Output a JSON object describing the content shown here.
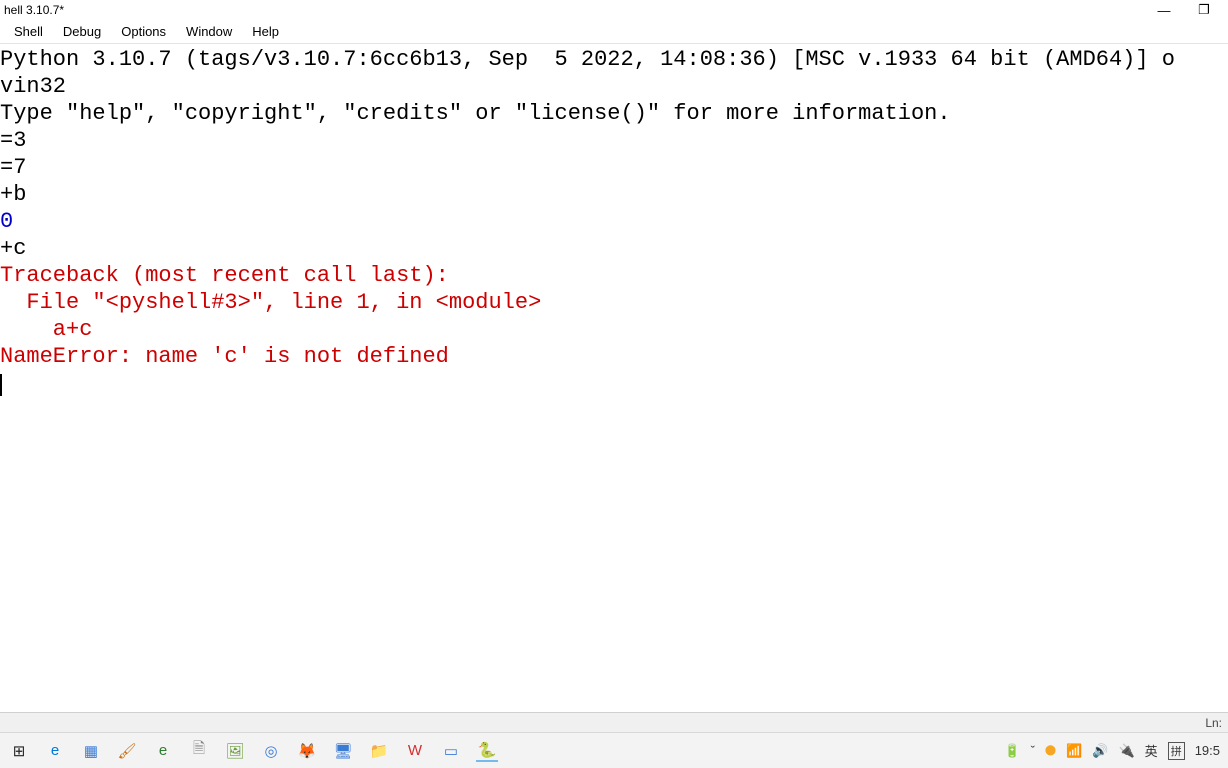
{
  "window": {
    "title": "hell 3.10.7*",
    "min": "—",
    "restore": "❐"
  },
  "menu": {
    "items": [
      "Shell",
      "Debug",
      "Options",
      "Window",
      "Help"
    ]
  },
  "shell": {
    "banner1": "Python 3.10.7 (tags/v3.10.7:6cc6b13, Sep  5 2022, 14:08:36) [MSC v.1933 64 bit (AMD64)] o",
    "banner2": "vin32",
    "banner3": "Type \"help\", \"copyright\", \"credits\" or \"license()\" for more information.",
    "in1": "=3",
    "in2": "=7",
    "in3": "+b",
    "out1": "0",
    "in4": "+c",
    "tb1": "Traceback (most recent call last):",
    "tb2": "  File \"<pyshell#3>\", line 1, in <module>",
    "tb3": "    a+c",
    "tb4": "NameError: name 'c' is not defined"
  },
  "status": {
    "text": "Ln: "
  },
  "taskbar": {
    "icons": [
      {
        "name": "start-icon",
        "glyph": "⊞",
        "color": "#222"
      },
      {
        "name": "edge-icon",
        "glyph": "e",
        "color": "#0078d7"
      },
      {
        "name": "calculator-icon",
        "glyph": "▦",
        "color": "#3a7bd5"
      },
      {
        "name": "paint-icon",
        "glyph": "🖌",
        "color": "#c96f12"
      },
      {
        "name": "edge2-icon",
        "glyph": "e",
        "color": "#2e7d32"
      },
      {
        "name": "document-icon",
        "glyph": "🗎",
        "color": "#888"
      },
      {
        "name": "image-icon",
        "glyph": "🖼",
        "color": "#6b9e3e"
      },
      {
        "name": "cortana-icon",
        "glyph": "◎",
        "color": "#3a7bd5"
      },
      {
        "name": "firefox-icon",
        "glyph": "🦊",
        "color": "#e66000"
      },
      {
        "name": "display-icon",
        "glyph": "🖥",
        "color": "#3a7bd5"
      },
      {
        "name": "explorer-icon",
        "glyph": "📁",
        "color": "#f6b73c"
      },
      {
        "name": "wps-icon",
        "glyph": "W",
        "color": "#d32f2f"
      },
      {
        "name": "monitor-icon",
        "glyph": "▭",
        "color": "#3a7bd5"
      },
      {
        "name": "python-icon",
        "glyph": "🐍",
        "color": "#3776ab",
        "active": true
      }
    ],
    "tray": {
      "battery": "🔋",
      "chevron": "ˇ",
      "shield": "⬤",
      "wifi": "📶",
      "sound": "🔊",
      "power": "🔌",
      "lang1": "英",
      "lang2": "拼",
      "time": "19:5"
    }
  }
}
